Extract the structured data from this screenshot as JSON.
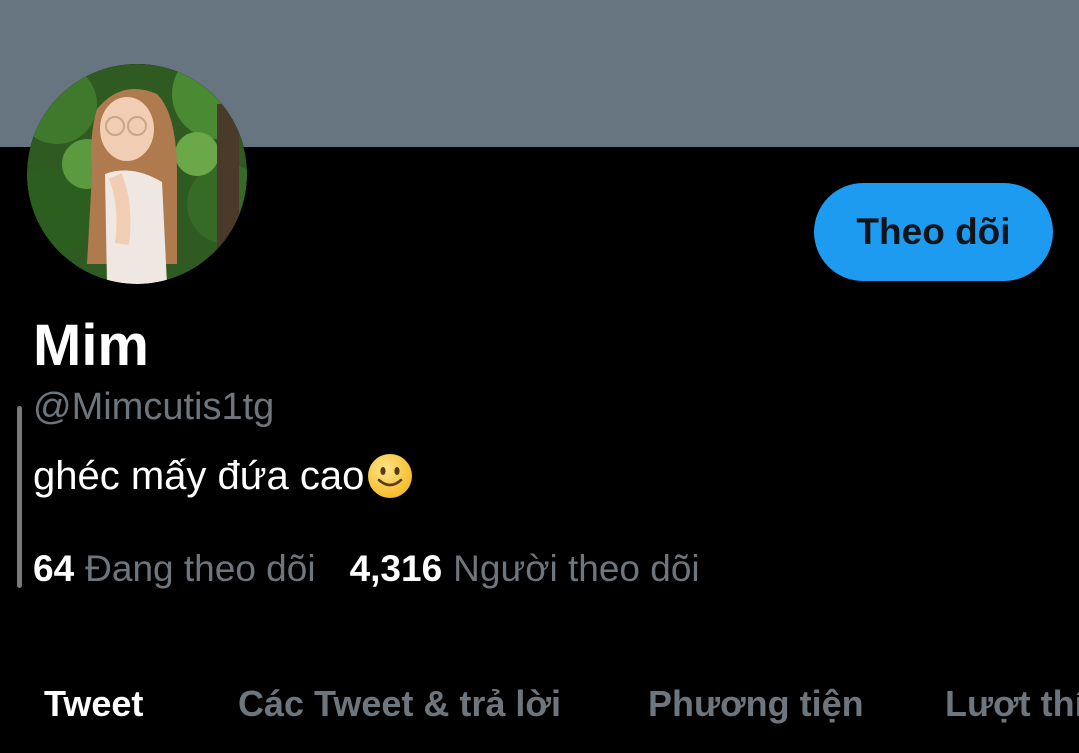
{
  "profile": {
    "display_name": "Mim",
    "handle": "@Mimcutis1tg",
    "bio": "ghéc mấy đứa cao",
    "bio_emoji": "slightly-smiling-face-emoji",
    "follow_label": "Theo dõi",
    "following_count": "64",
    "following_label": "Đang theo dõi",
    "followers_count": "4,316",
    "followers_label": "Người theo dõi"
  },
  "tabs": [
    {
      "label": "Tweet",
      "active": true
    },
    {
      "label": "Các Tweet & trả lời",
      "active": false
    },
    {
      "label": "Phương tiện",
      "active": false
    },
    {
      "label": "Lượt thí",
      "active": false
    }
  ],
  "colors": {
    "banner": "#66757f",
    "background": "#000000",
    "accent": "#1d9bf0",
    "secondary_text": "#6e767d"
  }
}
